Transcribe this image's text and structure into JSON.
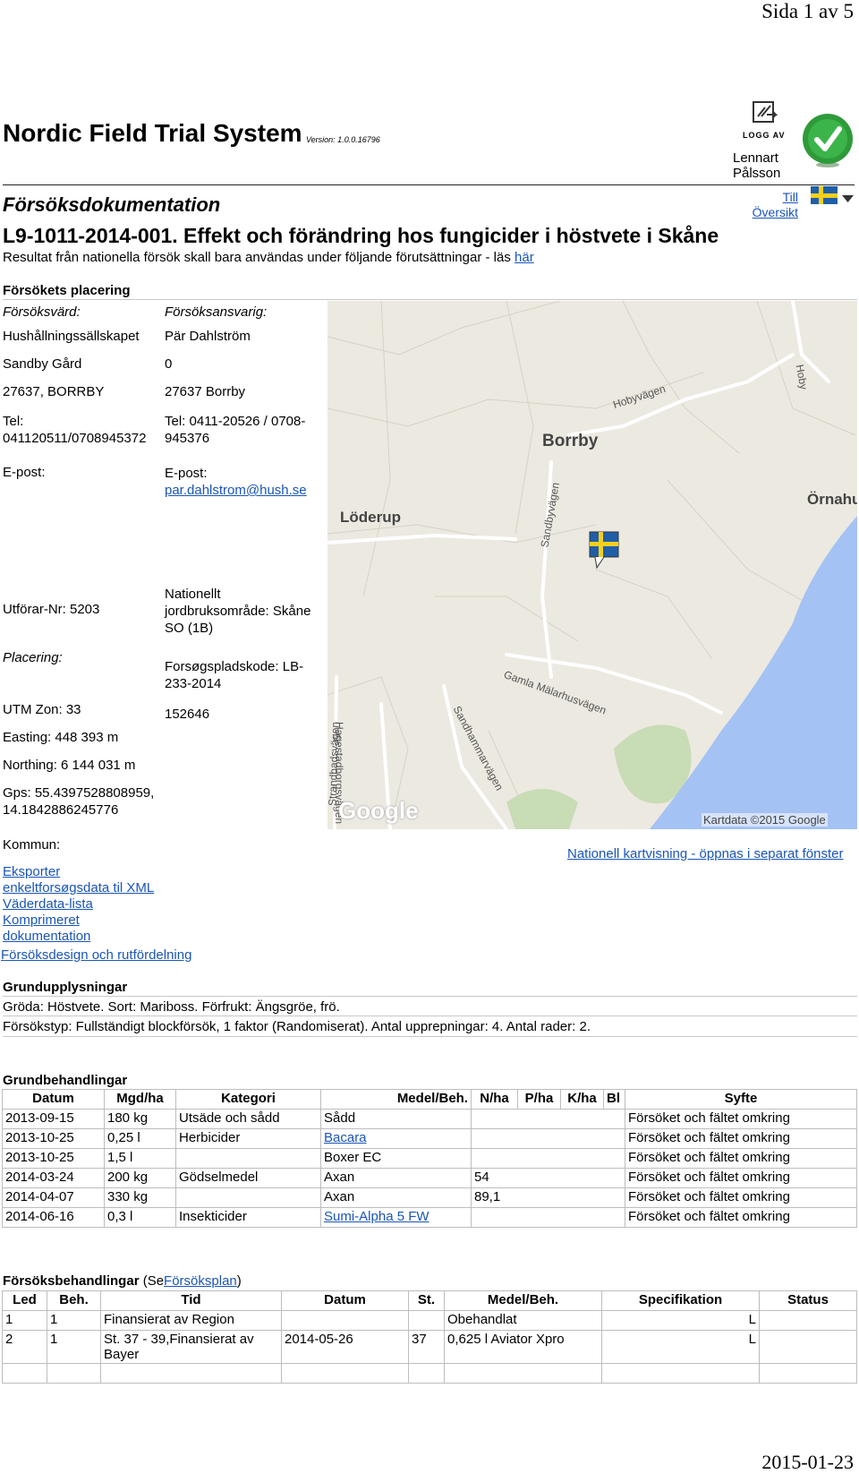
{
  "page": {
    "page_number": "Sida 1 av 5",
    "print_date": "2015-01-23"
  },
  "header": {
    "app_title": "Nordic Field Trial System",
    "version": "Version: 1.0.0.16796",
    "logout_label": "LOGG AV",
    "user_first": "Lennart",
    "user_last": "Pålsson",
    "overview_link_1": "Till",
    "overview_link_2": "Översikt"
  },
  "doc": {
    "section_title": "Försöksdokumentation",
    "trial_title": "L9-1011-2014-001. Effekt och förändring hos fungicider i höstvete i Skåne",
    "disclaimer": "Resultat från nationella försök skall bara användas under följande förutsättningar - läs",
    "disclaimer_link": "här"
  },
  "placement": {
    "heading": "Försökets placering",
    "host_label": "Försöksvärd:",
    "resp_label": "Försöksansvarig:",
    "host_name": "Hushållningssällskapet",
    "resp_name": "Pär Dahlström",
    "host_addr1": "Sandby Gård",
    "resp_addr1": "0",
    "host_addr2": "27637, BORRBY",
    "resp_addr2": "27637 Borrby",
    "host_tel_1": "Tel:",
    "host_tel_2": "041120511/0708945372",
    "resp_tel_1": "Tel: 0411-20526 / 0708-",
    "resp_tel_2": "945376",
    "host_email": "E-post:",
    "resp_email_label": "E-post:",
    "resp_email": "par.dahlstrom@hush.se",
    "executor": "Utförar-Nr: 5203",
    "region_1": "Nationellt",
    "region_2": "jordbruksområde: Skåne",
    "region_3": "SO (1B)",
    "placing_label": "Placering:",
    "site_code_1": "Forsøgspladskode: LB-",
    "site_code_2": "233-2014",
    "utm_zone": "UTM Zon: 33",
    "site_number": "152646",
    "easting": "Easting: 448 393 m",
    "northing": "Northing: 6 144 031 m",
    "gps_1": "Gps: 55.4397528808959,",
    "gps_2": "14.1842886245776",
    "municipality": "Kommun:",
    "link_export_1": "Eksporter",
    "link_export_2": "enkeltforsøgsdata til XML",
    "link_weather": "Väderdata-lista",
    "link_compressed_1": "Komprimeret",
    "link_compressed_2": "dokumentation",
    "link_design": "Försöksdesign och rutfördelning",
    "national_map_link": "Nationell kartvisning - öppnas i separat fönster"
  },
  "map": {
    "labels": {
      "borrby": "Borrby",
      "loderup": "Löderup",
      "ornahu": "Örnahu",
      "hobyvagen": "Hobyvägen",
      "hoby": "Hoby",
      "sandbyvagen": "Sandbyvägen",
      "gamla": "Gamla Mälarhusvägen",
      "hagestad": "Hagestadborgsvägen",
      "sandhammar": "Sandhammarvägen",
      "strand": "Strandbadsvägen",
      "google": "Google",
      "attribution": "Kartdata ©2015 Google"
    }
  },
  "basic": {
    "heading": "Grundupplysningar",
    "crop": "Gröda: Höstvete. Sort: Mariboss. Förfrukt: Ängsgröe, frö.",
    "trial_type": "Försökstyp: Fullständigt blockförsök, 1 faktor (Randomiserat). Antal upprepningar: 4. Antal rader: 2."
  },
  "base_treatments": {
    "heading": "Grundbehandlingar",
    "columns": [
      "Datum",
      "Mgd/ha",
      "Kategori",
      "Medel/Beh.",
      "N/ha",
      "P/ha",
      "K/ha",
      "Bl",
      "Syfte"
    ],
    "rows": [
      [
        "2013-09-15",
        "180 kg",
        "Utsäde och sådd",
        "Sådd",
        "",
        "",
        "",
        "",
        "Försöket och fältet omkring"
      ],
      [
        "2013-10-25",
        "0,25 l",
        "Herbicider",
        "Bacara",
        "",
        "",
        "",
        "",
        "Försöket och fältet omkring"
      ],
      [
        "2013-10-25",
        "1,5 l",
        "",
        "Boxer EC",
        "",
        "",
        "",
        "",
        "Försöket och fältet omkring"
      ],
      [
        "2014-03-24",
        "200 kg",
        "Gödselmedel",
        "Axan",
        "54",
        "",
        "",
        "",
        "Försöket och fältet omkring"
      ],
      [
        "2014-04-07",
        "330 kg",
        "",
        "Axan",
        "89,1",
        "",
        "",
        "",
        "Försöket och fältet omkring"
      ],
      [
        "2014-06-16",
        "0,3 l",
        "Insekticider",
        "Sumi-Alpha 5 FW",
        "",
        "",
        "",
        "",
        "Försöket och fältet omkring"
      ]
    ]
  },
  "trial_treatments": {
    "heading": "Försöksbehandlingar",
    "see_prefix": "(Se",
    "plan_link": "Försöksplan",
    "see_suffix": ")",
    "columns": [
      "Led",
      "Beh.",
      "Tid",
      "Datum",
      "St.",
      "Medel/Beh.",
      "Specifikation",
      "Status"
    ],
    "rows": [
      {
        "led": "1",
        "beh": "1",
        "tid_1": "Finansierat av Region",
        "tid_2": "",
        "datum": "",
        "st": "",
        "medel": "Obehandlat",
        "spec": "L",
        "status": ""
      },
      {
        "led": "2",
        "beh": "1",
        "tid_1": "St. 37 - 39,Finansierat av",
        "tid_2": "Bayer",
        "datum": "2014-05-26",
        "st": "37",
        "medel": "0,625 l  Aviator Xpro",
        "spec": "L",
        "status": ""
      }
    ]
  }
}
